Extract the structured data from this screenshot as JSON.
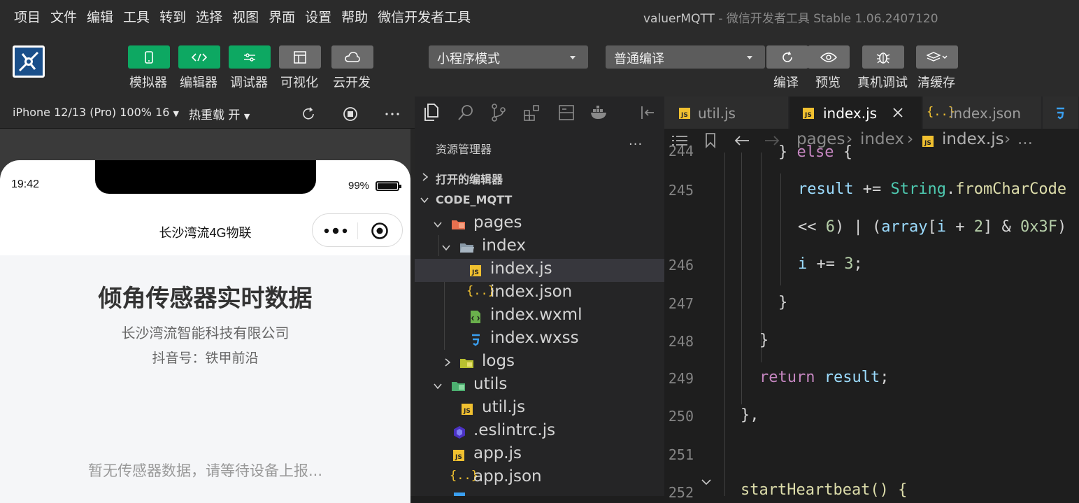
{
  "menu": {
    "items": [
      "项目",
      "文件",
      "编辑",
      "工具",
      "转到",
      "选择",
      "视图",
      "界面",
      "设置",
      "帮助",
      "微信开发者工具"
    ],
    "window_title": "valuerMQTT",
    "window_subtitle": " - 微信开发者工具 Stable 1.06.2407120"
  },
  "toolbar": {
    "simulator_label": "模拟器",
    "editor_label": "编辑器",
    "debugger_label": "调试器",
    "visual_label": "可视化",
    "cloud_label": "云开发",
    "mode_select": "小程序模式",
    "compile_select": "普通编译",
    "compile_label": "编译",
    "preview_label": "预览",
    "realdebug_label": "真机调试",
    "clearcache_label": "清缓存",
    "accent": "#0da862"
  },
  "simulator": {
    "device": "iPhone 12/13 (Pro) 100% 16",
    "hot_reload": "热重载 开",
    "status_time": "19:42",
    "status_battery": "99%",
    "nav_title": "长沙湾流4G物联",
    "heading": "倾角传感器实时数据",
    "company": "长沙湾流智能科技有限公司",
    "douyin": "抖音号：铁甲前沿",
    "empty_text": "暂无传感器数据，请等待设备上报..."
  },
  "explorer": {
    "title": "资源管理器",
    "more": "···",
    "open_editors": "打开的编辑器",
    "project": "CODE_MQTT",
    "tree": {
      "pages": "pages",
      "index": "index",
      "index_js": "index.js",
      "index_json": "index.json",
      "index_wxml": "index.wxml",
      "index_wxss": "index.wxss",
      "logs": "logs",
      "utils": "utils",
      "util_js": "util.js",
      "eslintrc": ".eslintrc.js",
      "app_js": "app.js",
      "app_json": "app.json"
    }
  },
  "editor": {
    "tabs": {
      "t1": "util.js",
      "t2": "index.js",
      "t3": "index.json"
    },
    "breadcrumbs": {
      "b1": "pages",
      "b2": "index",
      "b3": "index.js",
      "b4": "..."
    },
    "line_numbers": [
      "244",
      "245",
      "246",
      "247",
      "248",
      "249",
      "250",
      "251",
      "252"
    ],
    "code": {
      "l244_a": "} ",
      "l244_b": "else",
      "l244_c": " {",
      "l245_a": "result",
      "l245_b": " += ",
      "l245_c": "String",
      "l245_d": ".",
      "l245_e": "fromCharCode",
      "l245w_a": "<< ",
      "l245w_b": "6",
      "l245w_c": ") | (",
      "l245w_d": "array",
      "l245w_e": "[",
      "l245w_f": "i",
      "l245w_g": " + ",
      "l245w_h": "2",
      "l245w_i": "] & ",
      "l245w_j": "0x3F",
      "l245w_k": ")",
      "l246_a": "i",
      "l246_b": " += ",
      "l246_c": "3",
      "l246_d": ";",
      "l247": "}",
      "l248": "}",
      "l249_a": "return",
      "l249_b": " result",
      "l249_c": ";",
      "l250": "},",
      "l252": "startHeartbeat() {"
    }
  }
}
